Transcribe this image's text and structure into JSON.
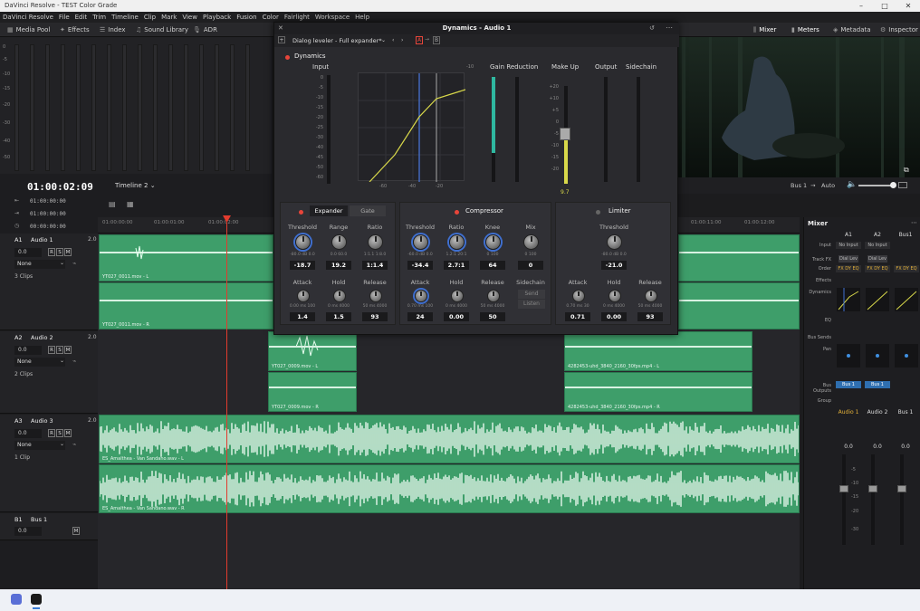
{
  "window": {
    "title": "DaVinci Resolve - TEST Color Grade",
    "buttons": [
      "–",
      "□",
      "✕"
    ]
  },
  "menu": [
    "DaVinci Resolve",
    "File",
    "Edit",
    "Trim",
    "Timeline",
    "Clip",
    "Mark",
    "View",
    "Playback",
    "Fusion",
    "Color",
    "Fairlight",
    "Workspace",
    "Help"
  ],
  "toolbar": {
    "left": [
      {
        "label": "Media Pool",
        "icon": "media-pool-icon"
      },
      {
        "label": "Effects",
        "icon": "effects-icon"
      },
      {
        "label": "Index",
        "icon": "index-icon"
      },
      {
        "label": "Sound Library",
        "icon": "sound-library-icon"
      },
      {
        "label": "ADR",
        "icon": "mic-icon"
      }
    ],
    "right": [
      {
        "label": "Mixer",
        "icon": "mixer-icon"
      },
      {
        "label": "Meters",
        "icon": "meters-icon"
      },
      {
        "label": "Metadata",
        "icon": "metadata-icon"
      },
      {
        "label": "Inspector",
        "icon": "inspector-icon"
      }
    ]
  },
  "meters_scale": [
    "0",
    "-5",
    "-10",
    "-15",
    "-20",
    "-30",
    "-40",
    "-50"
  ],
  "timeline": {
    "timecode": "01:00:02:09",
    "name": "Timeline 2",
    "row_timecodes": [
      "01:00:00:00",
      "01:00:00:00",
      "00:00:00:00"
    ],
    "ruler": [
      "01:00:00:00",
      "01:00:01:00",
      "01:00:02:00",
      "01:00:11:00",
      "01:00:12:00"
    ],
    "tracks": [
      {
        "id": "A1",
        "name": "Audio 1",
        "level": "2.0",
        "db": "0.0",
        "mode": "None",
        "clips": "3 Clips"
      },
      {
        "id": "A2",
        "name": "Audio 2",
        "level": "2.0",
        "db": "0.0",
        "mode": "None",
        "clips": "2 Clips"
      },
      {
        "id": "A3",
        "name": "Audio 3",
        "level": "2.0",
        "db": "0.0",
        "mode": "None",
        "clips": "1 Clip"
      },
      {
        "id": "B1",
        "name": "Bus 1",
        "level": "",
        "db": "0.0",
        "mode": "",
        "clips": ""
      }
    ],
    "clip_names": [
      "YT027_0011.mov - L",
      "YT027_0011.mov - R",
      "YT027_0009.mov - L",
      "YT027_0009.mov - R",
      "4282453-uhd_3840_2160_30fps.mp4 - L",
      "4282453-uhd_3840_2160_30fps.mp4 - R",
      "ES_Amalthea - Van Sandano.wav - L",
      "ES_Amalthea - Van Sandano.wav - R"
    ],
    "track_buttons": [
      "R",
      "S",
      "M"
    ]
  },
  "viewer_bar": {
    "bus": "Bus 1",
    "auto": "Auto"
  },
  "dynamics": {
    "title": "Dynamics - Audio 1",
    "preset": "Dialog leveler - Full expander*",
    "ab": [
      "A",
      "B"
    ],
    "enable_label": "Dynamics",
    "meters": {
      "input": "Input",
      "gain_reduction": "Gain Reduction",
      "makeup": "Make Up",
      "output": "Output",
      "sidechain": "Sidechain",
      "makeup_value": "9.7"
    },
    "graph_labels": [
      "-60",
      "-40",
      "-20",
      "-10"
    ],
    "input_scale": [
      "0",
      "-5",
      "-10",
      "-15",
      "-20",
      "-25",
      "-30",
      "-40",
      "-45",
      "-50",
      "-60"
    ],
    "makeup_scale": [
      "+20",
      "+10",
      "+5",
      "0",
      "-5",
      "-10",
      "-15",
      "-20"
    ],
    "expander": {
      "tabs": [
        "Expander",
        "Gate"
      ],
      "threshold": {
        "label": "Threshold",
        "value": "-18.7",
        "scale": "-80.0 dB  0.0"
      },
      "range": {
        "label": "Range",
        "value": "19.2",
        "scale": "0.0  60.0"
      },
      "ratio": {
        "label": "Ratio",
        "value": "1:1.4",
        "scale": "1:1.1  1:8.0"
      },
      "attack": {
        "label": "Attack",
        "value": "1.4",
        "scale": "0.00  ms  100"
      },
      "hold": {
        "label": "Hold",
        "value": "1.5",
        "scale": "0  ms  4000"
      },
      "release": {
        "label": "Release",
        "value": "93",
        "scale": "50  ms  4000"
      }
    },
    "compressor": {
      "title": "Compressor",
      "threshold": {
        "label": "Threshold",
        "value": "-34.4",
        "scale": "-60.0 dB  0.0"
      },
      "ratio": {
        "label": "Ratio",
        "value": "2.7:1",
        "scale": "1.2:1  20:1"
      },
      "knee": {
        "label": "Knee",
        "value": "64",
        "scale": "0  100"
      },
      "mix": {
        "label": "Mix",
        "value": "0",
        "scale": "0  100"
      },
      "attack": {
        "label": "Attack",
        "value": "24",
        "scale": "0.70  ms  100"
      },
      "hold": {
        "label": "Hold",
        "value": "0.00",
        "scale": "0  ms  4000"
      },
      "release": {
        "label": "Release",
        "value": "50",
        "scale": "50  ms  4000"
      },
      "sidechain": {
        "label": "Sidechain",
        "send": "Send",
        "listen": "Listen"
      }
    },
    "limiter": {
      "title": "Limiter",
      "threshold": {
        "label": "Threshold",
        "value": "-21.0",
        "scale": "-80.0 dB  0.0"
      },
      "attack": {
        "label": "Attack",
        "value": "0.71",
        "scale": "0.70  ms  30"
      },
      "hold": {
        "label": "Hold",
        "value": "0.00",
        "scale": "0  ms  4000"
      },
      "release": {
        "label": "Release",
        "value": "93",
        "scale": "50  ms  4000"
      }
    }
  },
  "mixer": {
    "title": "Mixer",
    "channels": [
      "A1",
      "A2",
      "Bus1"
    ],
    "rows": [
      "Input",
      "Track FX",
      "Order",
      "Effects",
      "Dynamics",
      "EQ",
      "Bus Sends",
      "Pan",
      "Bus Outputs",
      "Group"
    ],
    "inputs": [
      "No Input",
      "No Input"
    ],
    "order": [
      "FX DY EQ",
      "FX DY EQ",
      "FX DY EQ"
    ],
    "dial": [
      "Dial Lev",
      "Dial Lev"
    ],
    "bus_out": [
      "Bus 1",
      "Bus 1"
    ],
    "names": [
      "Audio 1",
      "Audio 2",
      "Bus 1"
    ],
    "levels": [
      "0.0",
      "0.0",
      "0.0"
    ],
    "fader_scale": [
      "0",
      "-5",
      "-10",
      "-15",
      "-20",
      "-30",
      "-40",
      "-50"
    ]
  },
  "colors": {
    "clip": "#3e9e6a",
    "playhead": "#e23b2e",
    "accent": "#3f6fd0",
    "gain": "#2fb8a0",
    "curve": "#d8d84a"
  }
}
